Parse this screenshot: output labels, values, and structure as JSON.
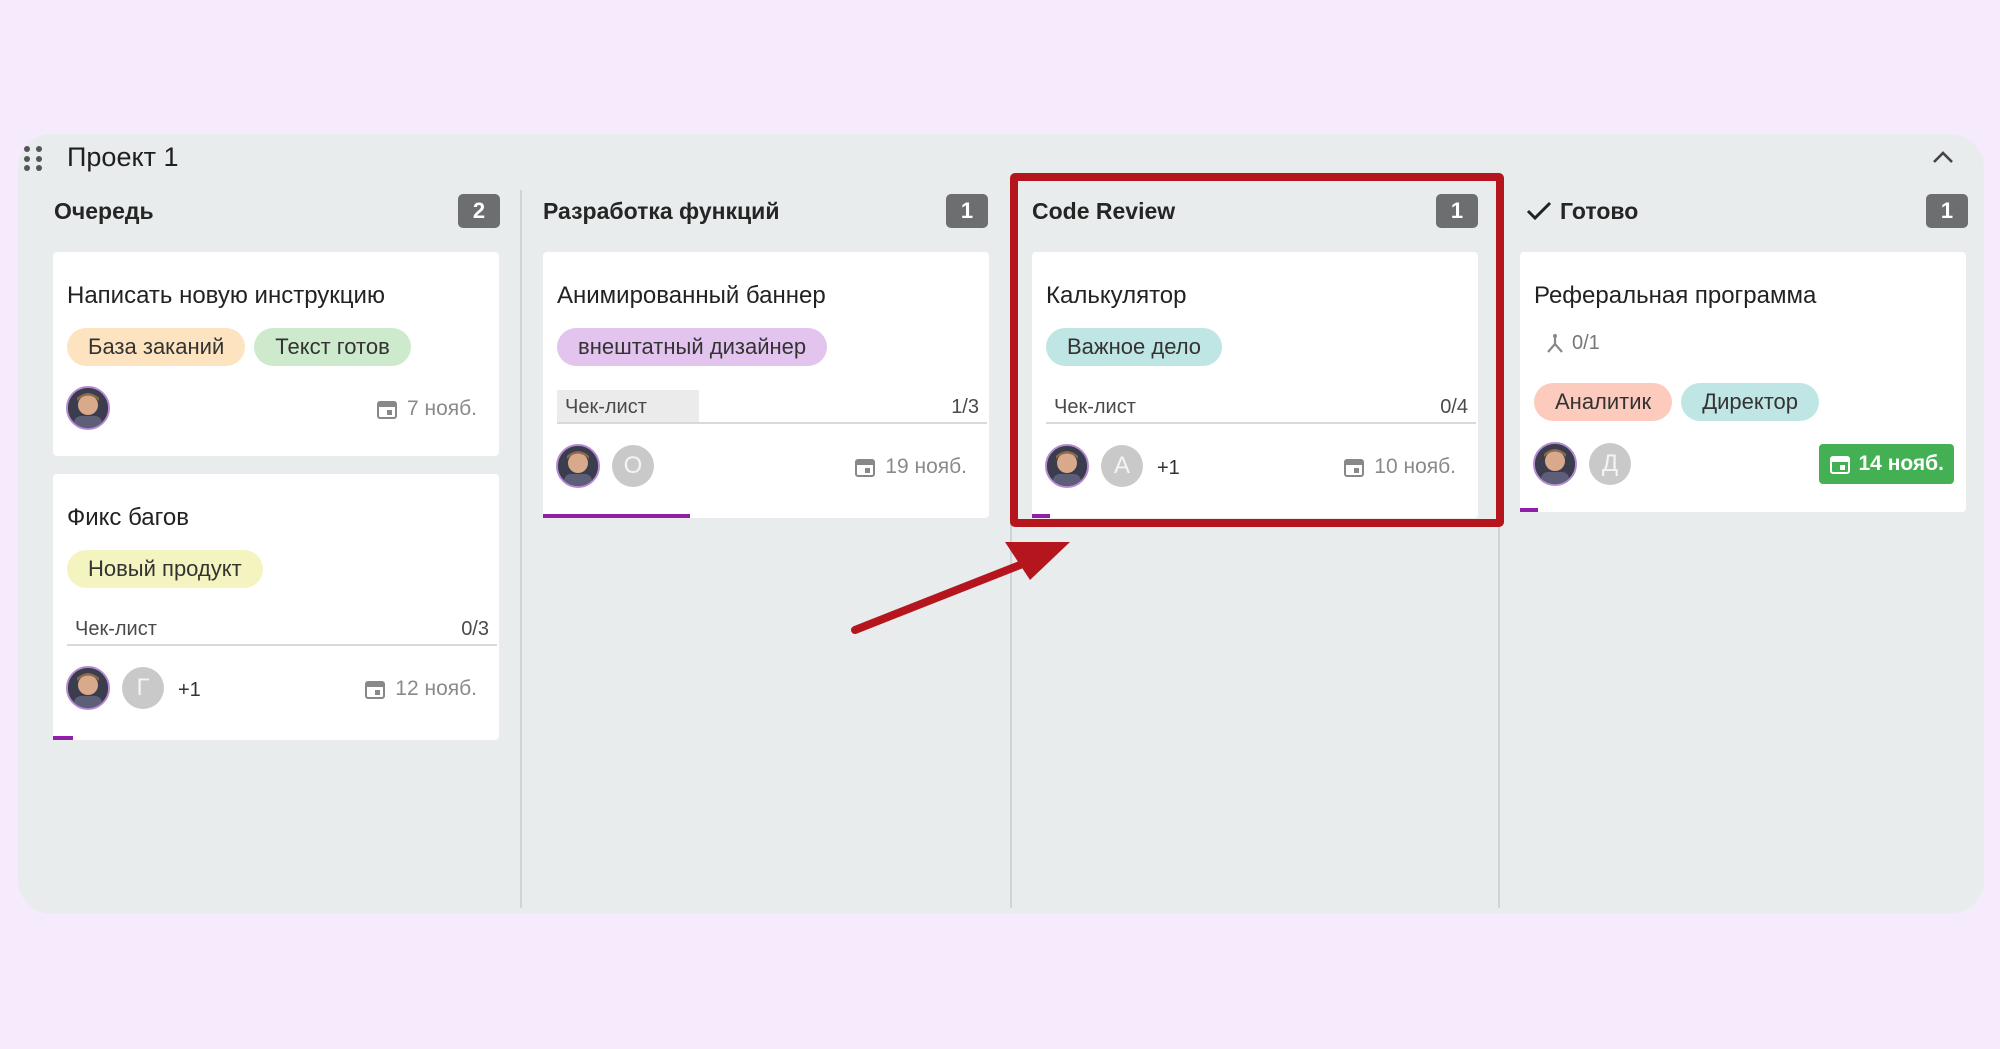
{
  "project": {
    "title": "Проект 1"
  },
  "columns": [
    {
      "title": "Очередь",
      "count": "2"
    },
    {
      "title": "Разработка функций",
      "count": "1"
    },
    {
      "title": "Code Review",
      "count": "1"
    },
    {
      "title": "Готово",
      "count": "1"
    }
  ],
  "cards": {
    "queue1": {
      "title": "Написать новую инструкцию",
      "tags": [
        "База заканий",
        "Текст готов"
      ],
      "due": "7 нояб."
    },
    "queue2": {
      "title": "Фикс багов",
      "tags": [
        "Новый продукт"
      ],
      "checklist_label": "Чек-лист",
      "checklist_count": "0/3",
      "assignee_letter": "Г",
      "more": "+1",
      "due": "12 нояб."
    },
    "dev1": {
      "title": "Анимированный баннер",
      "tags": [
        "внештатный дизайнер"
      ],
      "checklist_label": "Чек-лист",
      "checklist_count": "1/3",
      "assignee_letter": "О",
      "due": "19 нояб.",
      "checklist_progress": 0.33
    },
    "review1": {
      "title": "Калькулятор",
      "tags": [
        "Важное дело"
      ],
      "checklist_label": "Чек-лист",
      "checklist_count": "0/4",
      "assignee_letter": "А",
      "more": "+1",
      "due": "10 нояб."
    },
    "done1": {
      "title": "Реферальная программа",
      "subtasks": "0/1",
      "tags": [
        "Аналитик",
        "Директор"
      ],
      "assignee_letter": "Д",
      "due": "14 нояб."
    }
  },
  "colors": {
    "tag_orange": "#fde3bf",
    "tag_green": "#cdeacd",
    "tag_yellow": "#f3f4c0",
    "tag_purple": "#e3c4ef",
    "tag_teal": "#bfe6e4",
    "tag_salmon": "#fccbbd",
    "highlight": "#b5161e",
    "due_done": "#43b054",
    "progress": "#8e1fa6"
  },
  "icons": [
    "drag-handle-icon",
    "chevron-up-icon",
    "check-icon",
    "calendar-icon",
    "subtask-icon",
    "annotation-arrow"
  ]
}
